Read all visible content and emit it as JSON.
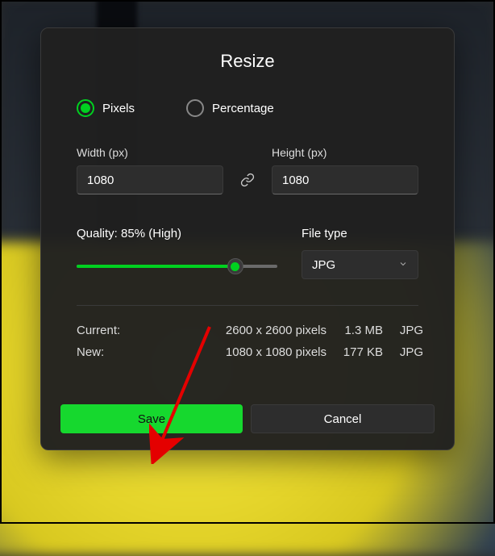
{
  "dialog": {
    "title": "Resize",
    "radio": {
      "pixels_label": "Pixels",
      "percentage_label": "Percentage",
      "selected": "pixels"
    },
    "width": {
      "label": "Width (px)",
      "value": "1080"
    },
    "height": {
      "label": "Height (px)",
      "value": "1080"
    },
    "quality": {
      "label": "Quality: 85% (High)",
      "percent": 85
    },
    "filetype": {
      "label": "File type",
      "value": "JPG"
    },
    "info": {
      "current_label": "Current:",
      "current_dims": "2600 x 2600 pixels",
      "current_size": "1.3 MB",
      "current_fmt": "JPG",
      "new_label": "New:",
      "new_dims": "1080 x 1080 pixels",
      "new_size": "177 KB",
      "new_fmt": "JPG"
    },
    "buttons": {
      "save": "Save",
      "cancel": "Cancel"
    }
  },
  "colors": {
    "accent": "#00d020",
    "primary_button": "#16d82e"
  }
}
